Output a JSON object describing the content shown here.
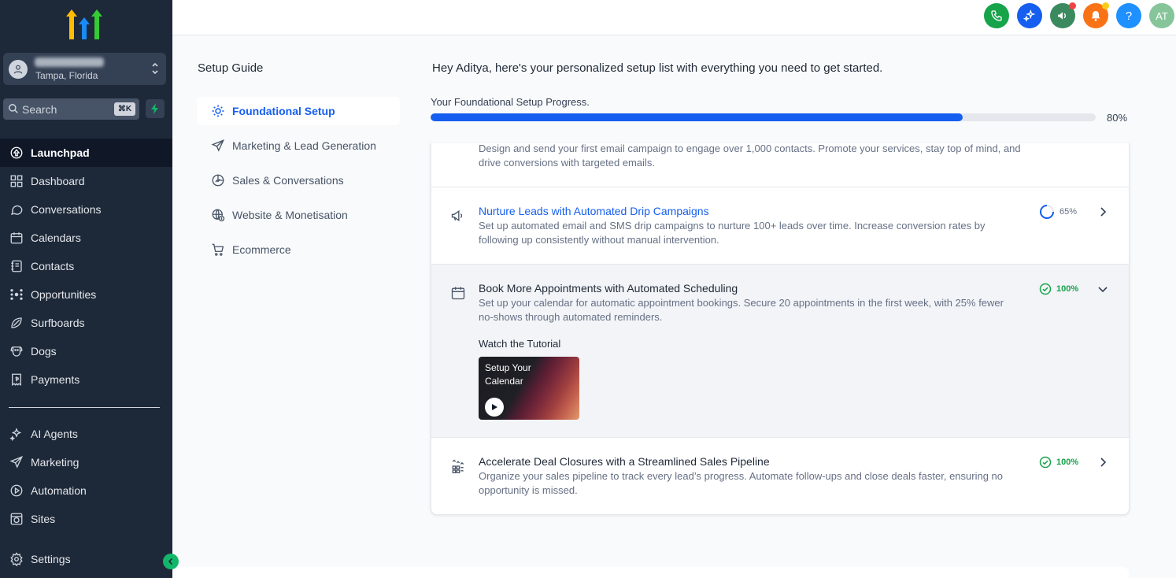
{
  "sidebar": {
    "location": {
      "name": "",
      "city": "Tampa, Florida"
    },
    "search": {
      "placeholder": "Search",
      "shortcut": "⌘K"
    },
    "nav_items": [
      {
        "label": "Launchpad",
        "icon": "rocket-icon",
        "active": true
      },
      {
        "label": "Dashboard",
        "icon": "grid-icon"
      },
      {
        "label": "Conversations",
        "icon": "chat-icon"
      },
      {
        "label": "Calendars",
        "icon": "calendar-icon"
      },
      {
        "label": "Contacts",
        "icon": "contacts-icon"
      },
      {
        "label": "Opportunities",
        "icon": "network-icon"
      },
      {
        "label": "Surfboards",
        "icon": "surfboard-icon"
      },
      {
        "label": "Dogs",
        "icon": "dog-icon"
      },
      {
        "label": "Payments",
        "icon": "receipt-icon"
      }
    ],
    "nav_items_secondary": [
      {
        "label": "AI Agents",
        "icon": "sparkles-icon"
      },
      {
        "label": "Marketing",
        "icon": "send-icon"
      },
      {
        "label": "Automation",
        "icon": "automation-icon"
      },
      {
        "label": "Sites",
        "icon": "globe-icon"
      }
    ],
    "settings_label": "Settings"
  },
  "topbar": {
    "buttons": [
      {
        "icon": "phone-icon",
        "color": "#16a34a"
      },
      {
        "icon": "ai-sparkle-icon",
        "color": "#155eef"
      },
      {
        "icon": "megaphone-icon",
        "color": "#3b8a5f",
        "badge": "#ef4444"
      },
      {
        "icon": "bell-icon",
        "color": "#f97316",
        "badge": "#facc15"
      },
      {
        "icon": "help-icon",
        "color": "#1e90ff",
        "text": "?"
      },
      {
        "icon": "avatar",
        "color": "#86c59a",
        "text": "AT"
      }
    ]
  },
  "guide": {
    "title": "Setup Guide",
    "items": [
      {
        "label": "Foundational Setup",
        "icon": "sun-icon",
        "active": true
      },
      {
        "label": "Marketing & Lead Generation",
        "icon": "send-icon"
      },
      {
        "label": "Sales & Conversations",
        "icon": "chart-icon"
      },
      {
        "label": "Website & Monetisation",
        "icon": "globe-dollar-icon"
      },
      {
        "label": "Ecommerce",
        "icon": "cart-icon"
      }
    ]
  },
  "main": {
    "greeting": "Hey Aditya, here's your personalized setup list with everything you need to get started.",
    "progress_label": "Your Foundational Setup Progress.",
    "progress_value": 0.8,
    "progress_text": "80%",
    "tasks": [
      {
        "title": "",
        "desc": "Design and send your first email campaign to engage over 1,000 contacts. Promote your services, stay top of mind, and drive conversions with targeted emails."
      },
      {
        "title": "Nurture Leads with Automated Drip Campaigns",
        "desc": "Set up automated email and SMS drip campaigns to nurture 100+ leads over time. Increase conversion rates by following up consistently without manual intervention.",
        "status": "65%",
        "icon": "megaphone-icon"
      },
      {
        "title": "Book More Appointments with Automated Scheduling",
        "desc": "Set up your calendar for automatic appointment bookings. Secure 20 appointments in the first week, with 25% fewer no-shows through automated reminders.",
        "status": "100%",
        "icon": "calendar-icon",
        "expanded": true,
        "tutorial_label": "Watch the Tutorial",
        "video_title": "Setup Your Calendar"
      },
      {
        "title": "Accelerate Deal Closures with a Streamlined Sales Pipeline",
        "desc": "Organize your sales pipeline to track every lead’s progress. Automate follow-ups and close deals faster, ensuring no opportunity is missed.",
        "status": "100%",
        "icon": "pipeline-icon"
      }
    ]
  }
}
